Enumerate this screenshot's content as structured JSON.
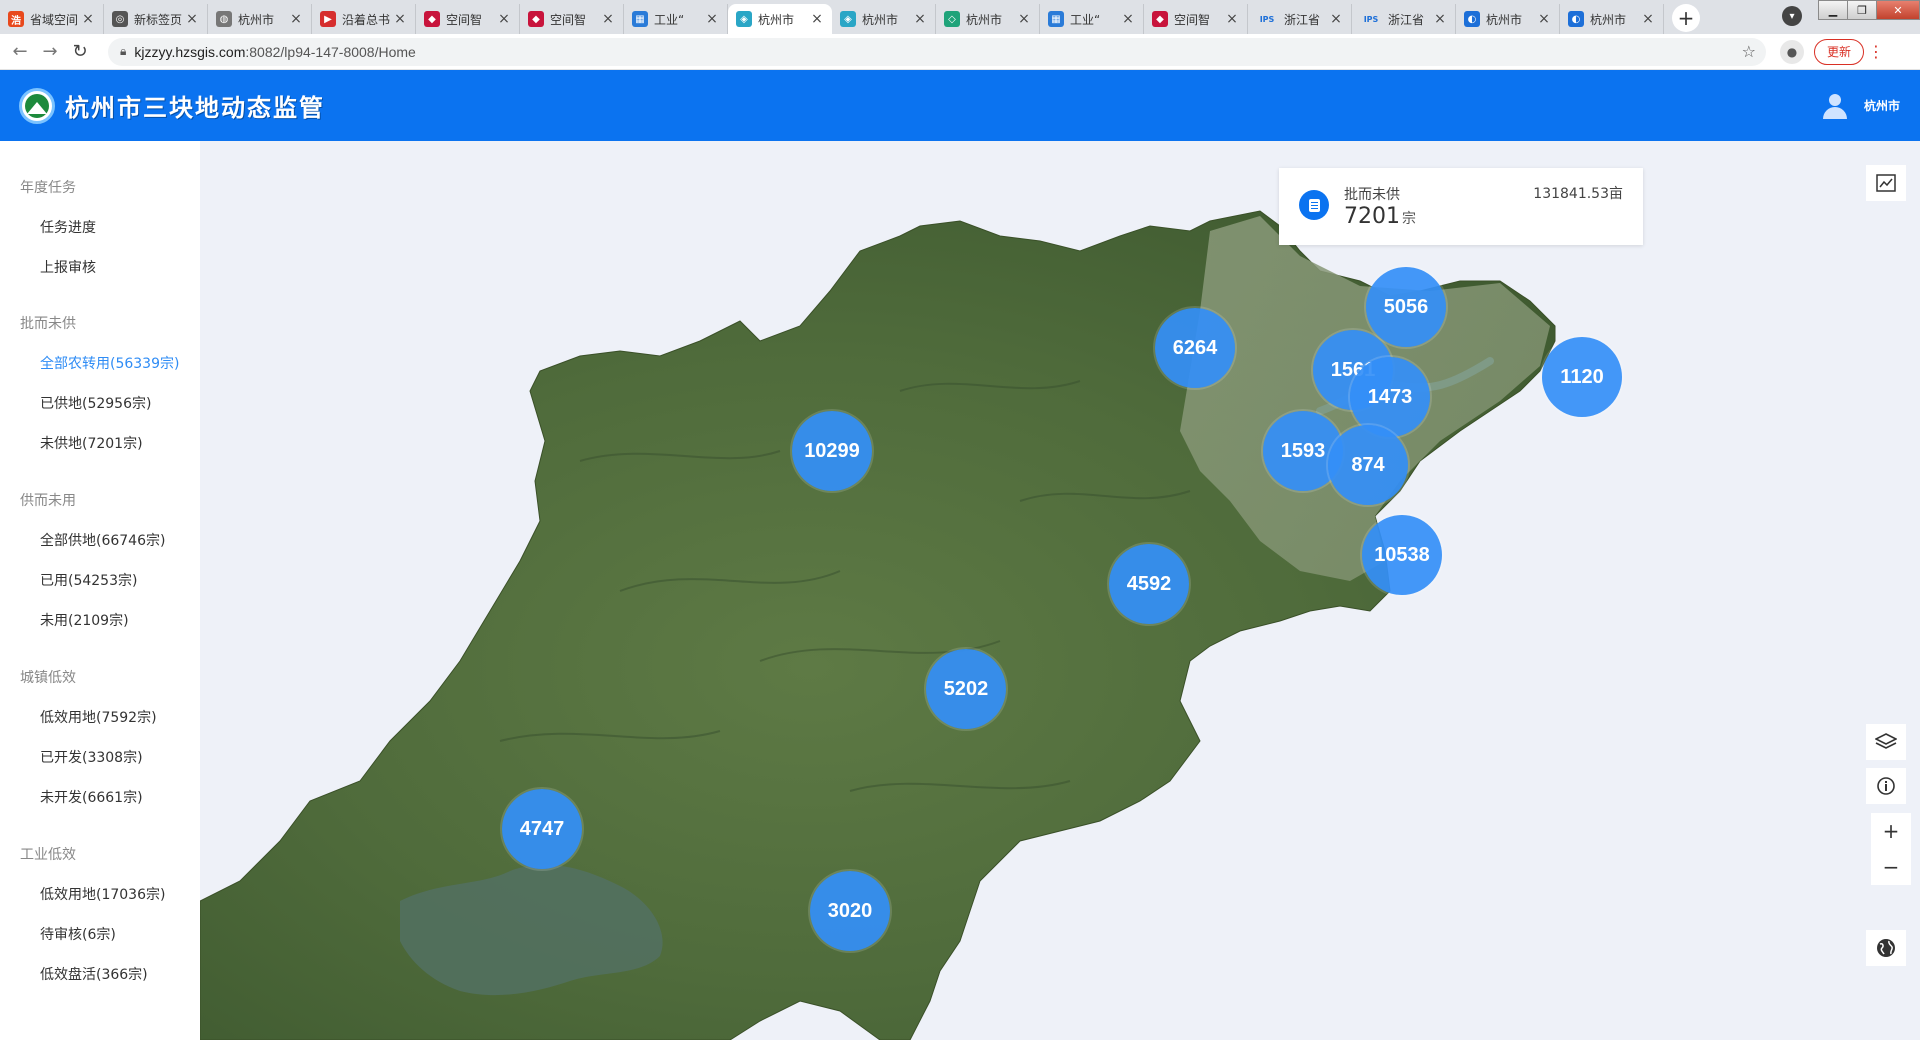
{
  "browser": {
    "tabs": [
      {
        "title": "省域空间",
        "fav_color": "#e8491d",
        "fav_text": "浩",
        "active": false
      },
      {
        "title": "新标签页",
        "fav_color": "#555555",
        "fav_text": "◎",
        "active": false
      },
      {
        "title": "杭州市",
        "fav_color": "#777777",
        "fav_text": "◍",
        "active": false
      },
      {
        "title": "沿着总书",
        "fav_color": "#d62e2e",
        "fav_text": "▶",
        "active": false
      },
      {
        "title": "空间智",
        "fav_color": "#c8143c",
        "fav_text": "◆",
        "active": false
      },
      {
        "title": "空间智",
        "fav_color": "#c8143c",
        "fav_text": "◆",
        "active": false
      },
      {
        "title": "工业“",
        "fav_color": "#2a7bd8",
        "fav_text": "▦",
        "active": false
      },
      {
        "title": "杭州市",
        "fav_color": "#2aa6c6",
        "fav_text": "◈",
        "active": true
      },
      {
        "title": "杭州市",
        "fav_color": "#2aa6c6",
        "fav_text": "◈",
        "active": false
      },
      {
        "title": "杭州市",
        "fav_color": "#1fa37a",
        "fav_text": "◇",
        "active": false
      },
      {
        "title": "工业“",
        "fav_color": "#2a7bd8",
        "fav_text": "▦",
        "active": false
      },
      {
        "title": "空间智",
        "fav_color": "#c8143c",
        "fav_text": "◆",
        "active": false
      },
      {
        "title": "浙江省",
        "fav_color": "#1d6fd8",
        "fav_text": "IPS",
        "active": false
      },
      {
        "title": "浙江省",
        "fav_color": "#1d6fd8",
        "fav_text": "IPS",
        "active": false
      },
      {
        "title": "杭州市",
        "fav_color": "#1d6fd8",
        "fav_text": "◐",
        "active": false
      },
      {
        "title": "杭州市",
        "fav_color": "#1d6fd8",
        "fav_text": "◐",
        "active": false
      }
    ],
    "url_host": "kjzzyy.hzsgis.com",
    "url_path": ":8082/lp94-147-8008/Home",
    "update_label": "更新"
  },
  "app": {
    "title": "杭州市三块地动态监管",
    "user": "杭州市"
  },
  "sidebar": {
    "sections": [
      {
        "title": "年度任务",
        "items": [
          {
            "label": "任务进度",
            "active": false
          },
          {
            "label": "上报审核",
            "active": false
          }
        ]
      },
      {
        "title": "批而未供",
        "items": [
          {
            "label": "全部农转用(56339宗)",
            "active": true
          },
          {
            "label": "已供地(52956宗)",
            "active": false
          },
          {
            "label": "未供地(7201宗)",
            "active": false
          }
        ]
      },
      {
        "title": "供而未用",
        "items": [
          {
            "label": "全部供地(66746宗)",
            "active": false
          },
          {
            "label": "已用(54253宗)",
            "active": false
          },
          {
            "label": "未用(2109宗)",
            "active": false
          }
        ]
      },
      {
        "title": "城镇低效",
        "items": [
          {
            "label": "低效用地(7592宗)",
            "active": false
          },
          {
            "label": "已开发(3308宗)",
            "active": false
          },
          {
            "label": "未开发(6661宗)",
            "active": false
          }
        ]
      },
      {
        "title": "工业低效",
        "items": [
          {
            "label": "低效用地(17036宗)",
            "active": false
          },
          {
            "label": "待审核(6宗)",
            "active": false
          },
          {
            "label": "低效盘活(366宗)",
            "active": false
          }
        ]
      }
    ]
  },
  "stat_card": {
    "label": "批而未供",
    "area": "131841.53亩",
    "count": "7201",
    "unit": "宗"
  },
  "clusters": [
    "5056",
    "6264",
    "1561",
    "1473",
    "1120",
    "10299",
    "1593",
    "874",
    "10538",
    "4592",
    "5202",
    "4747",
    "3020"
  ],
  "colors": {
    "brand": "#0b73f0",
    "cluster": "#348ff7",
    "sidebar_active": "#2f8cf5"
  },
  "icons": {
    "collapse": "chevron-right-icon",
    "chart": "trend-chart-icon",
    "layers": "layers-icon",
    "info": "info-icon",
    "zoom_in": "plus-icon",
    "zoom_out": "minus-icon",
    "globe": "globe-icon"
  }
}
